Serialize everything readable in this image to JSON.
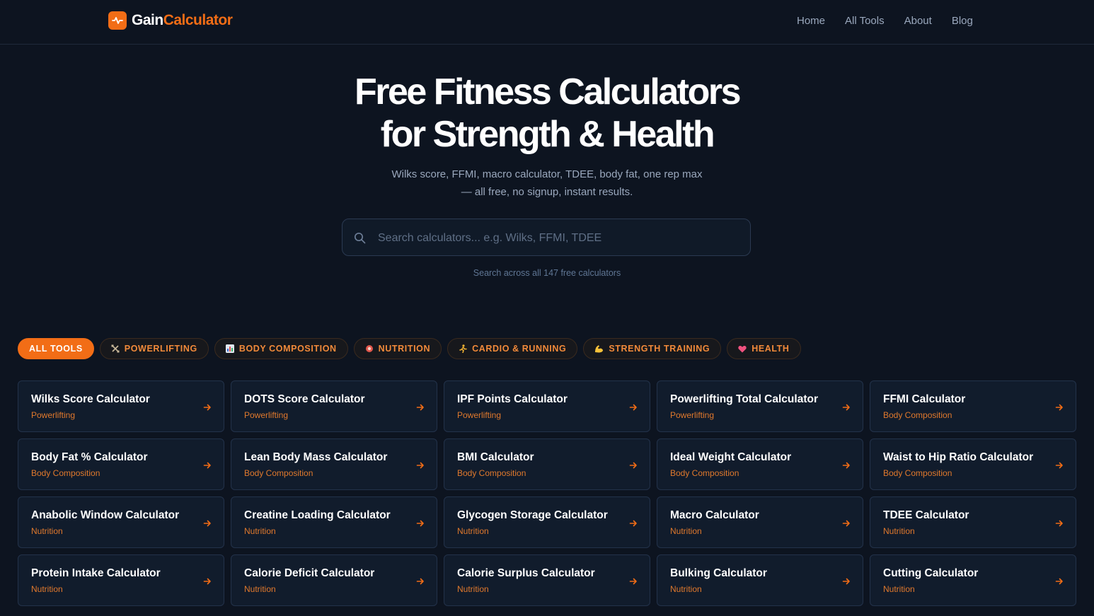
{
  "brand": {
    "name_part1": "Gain",
    "name_part2": "Calculator",
    "accent": "#f26d16"
  },
  "nav": {
    "links": [
      "Home",
      "All Tools",
      "About",
      "Blog"
    ]
  },
  "hero": {
    "title_line1": "Free Fitness Calculators",
    "title_line2": "for Strength & Health",
    "subtitle_line1": "Wilks score, FFMI, macro calculator, TDEE, body fat, one rep max",
    "subtitle_line2": "— all free, no signup, instant results."
  },
  "search": {
    "placeholder": "Search calculators... e.g. Wilks, FFMI, TDEE",
    "value": "",
    "hint": "Search across all 147 free calculators"
  },
  "filters": [
    {
      "label": "ALL TOOLS",
      "icon": "",
      "active": true
    },
    {
      "label": "POWERLIFTING",
      "icon": "dumbbell-icon",
      "active": false
    },
    {
      "label": "BODY COMPOSITION",
      "icon": "bar-chart-icon",
      "active": false
    },
    {
      "label": "NUTRITION",
      "icon": "meat-icon",
      "active": false
    },
    {
      "label": "CARDIO & RUNNING",
      "icon": "runner-icon",
      "active": false
    },
    {
      "label": "STRENGTH TRAINING",
      "icon": "flexed-bicep-icon",
      "active": false
    },
    {
      "label": "HEALTH",
      "icon": "heart-icon",
      "active": false
    }
  ],
  "tools": [
    {
      "title": "Wilks Score Calculator",
      "category": "Powerlifting"
    },
    {
      "title": "DOTS Score Calculator",
      "category": "Powerlifting"
    },
    {
      "title": "IPF Points Calculator",
      "category": "Powerlifting"
    },
    {
      "title": "Powerlifting Total Calculator",
      "category": "Powerlifting"
    },
    {
      "title": "FFMI Calculator",
      "category": "Body Composition"
    },
    {
      "title": "Body Fat % Calculator",
      "category": "Body Composition"
    },
    {
      "title": "Lean Body Mass Calculator",
      "category": "Body Composition"
    },
    {
      "title": "BMI Calculator",
      "category": "Body Composition"
    },
    {
      "title": "Ideal Weight Calculator",
      "category": "Body Composition"
    },
    {
      "title": "Waist to Hip Ratio Calculator",
      "category": "Body Composition"
    },
    {
      "title": "Anabolic Window Calculator",
      "category": "Nutrition"
    },
    {
      "title": "Creatine Loading Calculator",
      "category": "Nutrition"
    },
    {
      "title": "Glycogen Storage Calculator",
      "category": "Nutrition"
    },
    {
      "title": "Macro Calculator",
      "category": "Nutrition"
    },
    {
      "title": "TDEE Calculator",
      "category": "Nutrition"
    },
    {
      "title": "Protein Intake Calculator",
      "category": "Nutrition"
    },
    {
      "title": "Calorie Deficit Calculator",
      "category": "Nutrition"
    },
    {
      "title": "Calorie Surplus Calculator",
      "category": "Nutrition"
    },
    {
      "title": "Bulking Calculator",
      "category": "Nutrition"
    },
    {
      "title": "Cutting Calculator",
      "category": "Nutrition"
    }
  ]
}
